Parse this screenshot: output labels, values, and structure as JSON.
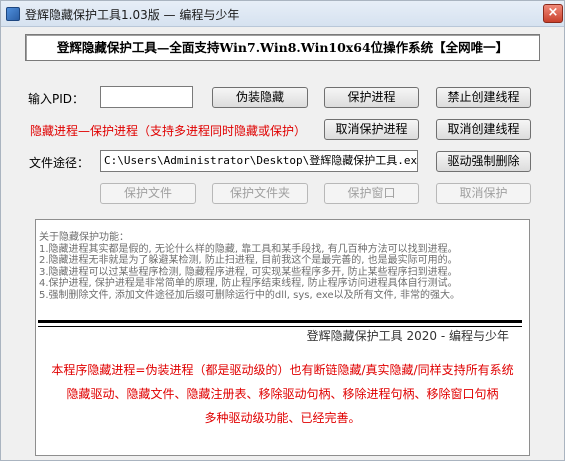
{
  "window": {
    "title": "登辉隐藏保护工具1.03版 — 编程与少年",
    "close_glyph": "×"
  },
  "banner": "登辉隐藏保护工具—全面支持Win7.Win8.Win10x64位操作系统【全网唯一】",
  "pid": {
    "label": "输入PID：",
    "value": ""
  },
  "buttons": {
    "fake_hide": "伪装隐藏",
    "protect_process": "保护进程",
    "forbid_thread": "禁止创建线程",
    "cancel_protect": "取消保护进程",
    "cancel_thread": "取消创建线程",
    "force_delete": "驱动强制删除",
    "protect_file": "保护文件",
    "protect_folder": "保护文件夹",
    "protect_window": "保护窗口",
    "cancel_protect_small": "取消保护"
  },
  "hint_red": "隐藏进程—保护进程（支持多进程同时隐藏或保护）",
  "path": {
    "label": "文件途径：",
    "value": "C:\\Users\\Administrator\\Desktop\\登辉隐藏保护工具.exe"
  },
  "info": {
    "lines": [
      "关于隐藏保护功能：",
      "1.隐藏进程其实都是假的, 无论什么样的隐藏, 靠工具和某手段找, 有几百种方法可以找到进程。",
      "2.隐藏进程无非就是为了躲避某检测, 防止扫进程, 目前我这个是最完善的, 也是最实际可用的。",
      "3.隐藏进程可以过某些程序检测, 隐藏程序进程, 可实现某些程序多开, 防止某些程序扫到进程。",
      "4.保护进程, 保护进程是非常简单的原理, 防止程序结束线程, 防止程序访问进程具体自行测试。",
      "5.强制删除文件, 添加文件途径加后缀可删除运行中的dll, sys, exe以及所有文件, 非常的强大。"
    ],
    "signature": "登辉隐藏保护工具   2020 - 编程与少年",
    "promo": [
      "本程序隐藏进程=伪装进程（都是驱动级的）也有断链隐藏/真实隐藏/同样支持所有系统",
      "隐藏驱动、隐藏文件、隐藏注册表、移除驱动句柄、移除进程句柄、移除窗口句柄",
      "多种驱动级功能、已经完善。"
    ]
  },
  "colors": {
    "accent_red": "#e00000",
    "window_bg": "#f0f0f0",
    "info_text": "#6e6e6e"
  }
}
